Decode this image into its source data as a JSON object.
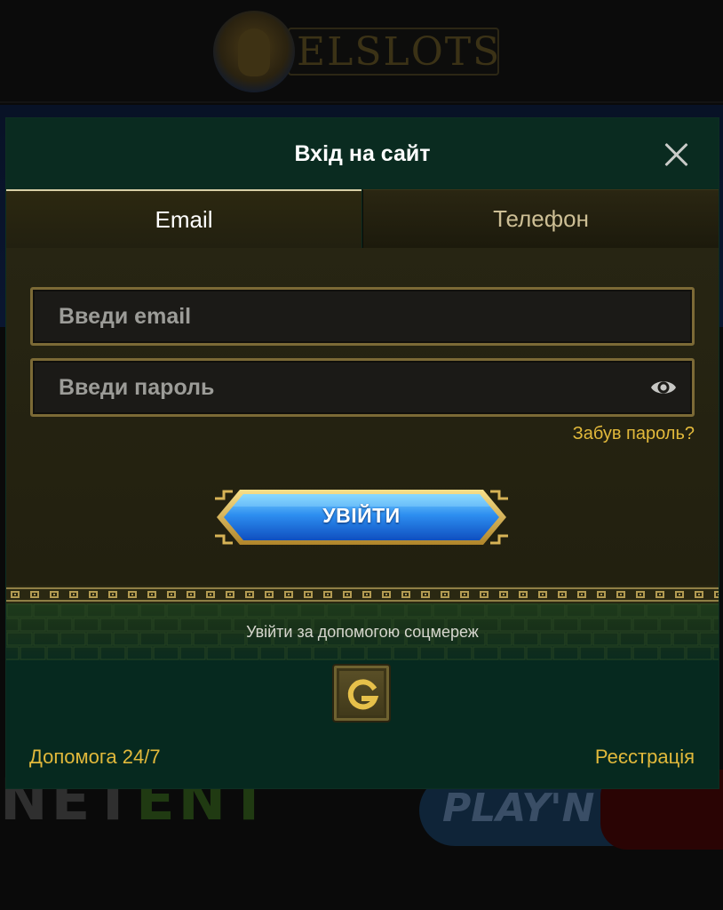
{
  "background": {
    "logo_text": "ELSLOTS",
    "provider_1": "NETENT",
    "provider_2": "PLAY'N GO"
  },
  "modal": {
    "title": "Вхід на сайт",
    "close_icon": "close-icon"
  },
  "tabs": [
    {
      "label": "Email",
      "active": true
    },
    {
      "label": "Телефон",
      "active": false
    }
  ],
  "form": {
    "email_placeholder": "Введи email",
    "email_value": "",
    "password_placeholder": "Введи пароль",
    "password_value": "",
    "password_toggle_icon": "eye-icon",
    "forgot_label": "Забув пароль?",
    "submit_label": "УВІЙТИ"
  },
  "social": {
    "label": "Увійти за допомогою соцмереж",
    "google_icon": "google-icon"
  },
  "footer": {
    "help_label": "Допомога 24/7",
    "register_label": "Реєстрація"
  },
  "colors": {
    "accent_gold": "#e2b93b",
    "modal_bg": "#06291f",
    "button_blue": "#1e7ee8",
    "field_border": "#7c6a36"
  }
}
